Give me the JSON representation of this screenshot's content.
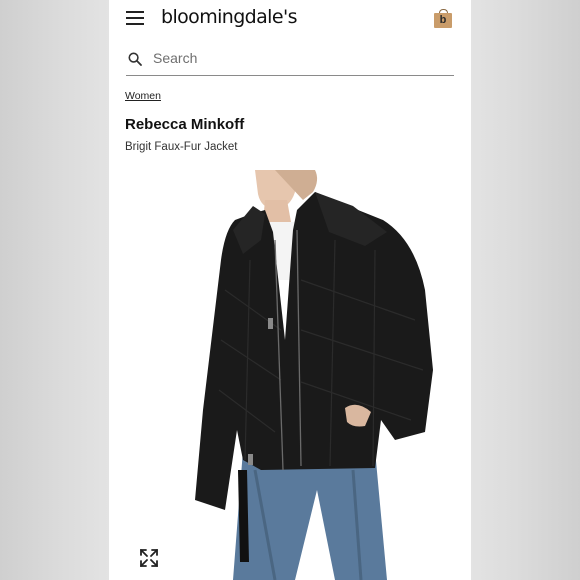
{
  "header": {
    "logo_text": "bloomingdale's",
    "bag_letter": "b"
  },
  "search": {
    "placeholder": "Search"
  },
  "breadcrumb": {
    "label": "Women"
  },
  "product": {
    "brand": "Rebecca Minkoff",
    "name": "Brigit Faux-Fur Jacket",
    "image_alt": "Woman wearing a black faux-fur jacket with zipper and jeans"
  },
  "colors": {
    "bag": "#c99c6a",
    "jacket": "#1a1a1a",
    "denim": "#5a7a9c"
  },
  "icons": [
    "menu-icon",
    "shopping-bag-icon",
    "search-icon",
    "expand-icon"
  ]
}
